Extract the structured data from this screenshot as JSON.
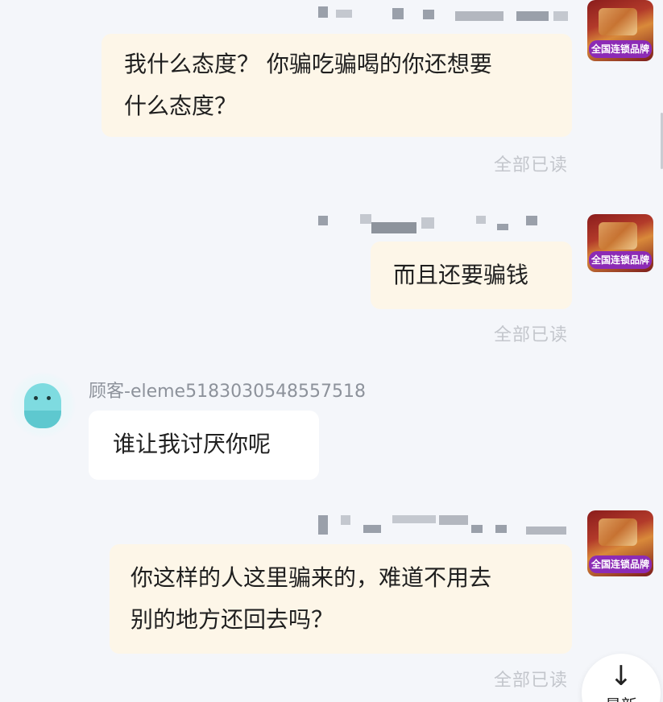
{
  "merchant": {
    "brand_badge": "全国连锁品牌"
  },
  "messages": [
    {
      "sender": "merchant",
      "lines": [
        "我什么态度？ 你骗吃骗喝的你还想要",
        "什么态度？"
      ],
      "status": "全部已读"
    },
    {
      "sender": "merchant",
      "lines": [
        "而且还要骗钱"
      ],
      "status": "全部已读"
    },
    {
      "sender": "customer",
      "name": "顾客-eleme5183030548557518",
      "lines": [
        "谁让我讨厌你呢"
      ]
    },
    {
      "sender": "merchant",
      "lines": [
        "你这样的人这里骗来的，难道不用去",
        "别的地方还回去吗？"
      ],
      "status": "全部已读"
    }
  ],
  "newest_button": {
    "icon": "arrow-down-icon",
    "label": "最新"
  },
  "colors": {
    "background": "#f4f6fa",
    "merchant_bubble": "#fdf6e8",
    "customer_bubble": "#ffffff",
    "brand_badge": "#8c2bb5",
    "read_status": "#c3c6cc"
  }
}
